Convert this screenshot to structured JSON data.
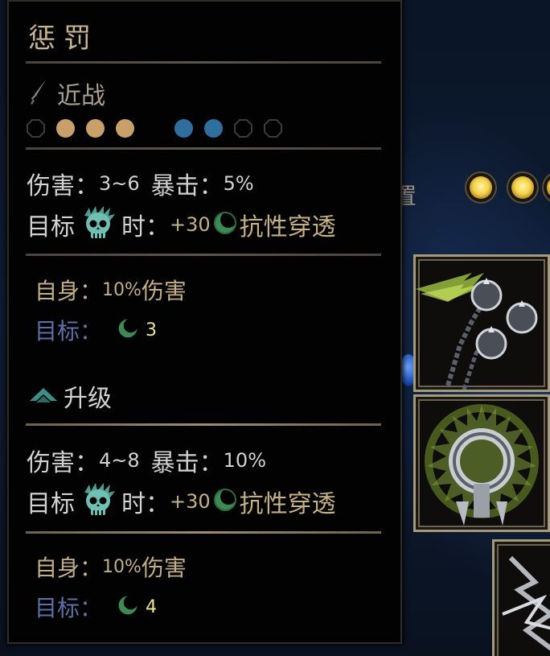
{
  "background": {
    "partial_label": "置"
  },
  "tooltip": {
    "title": "惩罚",
    "attack_type": "近战",
    "attack_type_icon": "dagger-icon",
    "position_pips": {
      "launch": [
        "empty",
        "tan",
        "tan",
        "tan"
      ],
      "target": [
        "blue",
        "blue",
        "empty",
        "empty"
      ]
    },
    "base": {
      "damage_label": "伤害：",
      "damage_value": "3~6",
      "crit_label": "暴击：",
      "crit_value": "5%",
      "target_label": "目标",
      "target_icon": "skull-icon",
      "when_label": "时：",
      "res_value": "+30",
      "res_icon": "moon-icon",
      "res_label": "抗性穿透",
      "self_label": "自身：",
      "self_value": "10%",
      "self_suffix": "伤害",
      "target_effect_label": "目标：",
      "target_effect_value": "3"
    },
    "upgrade": {
      "label": "升级",
      "icon": "upgrade-chevron-icon",
      "damage_label": "伤害：",
      "damage_value": "4~8",
      "crit_label": "暴击：",
      "crit_value": "10%",
      "target_label": "目标",
      "when_label": "时：",
      "res_value": "+30",
      "res_label": "抗性穿透",
      "self_label": "自身：",
      "self_value": "10%",
      "self_suffix": "伤害",
      "target_effect_label": "目标：",
      "target_effect_value": "4"
    }
  },
  "colors": {
    "gold_text": "#c7b490",
    "tan_pip": "#c9a06a",
    "blue_pip": "#2e6f9e",
    "skull_teal": "#6fbfb2",
    "target_blue": "#5d6fa8",
    "yellow_number": "#efe48e"
  }
}
